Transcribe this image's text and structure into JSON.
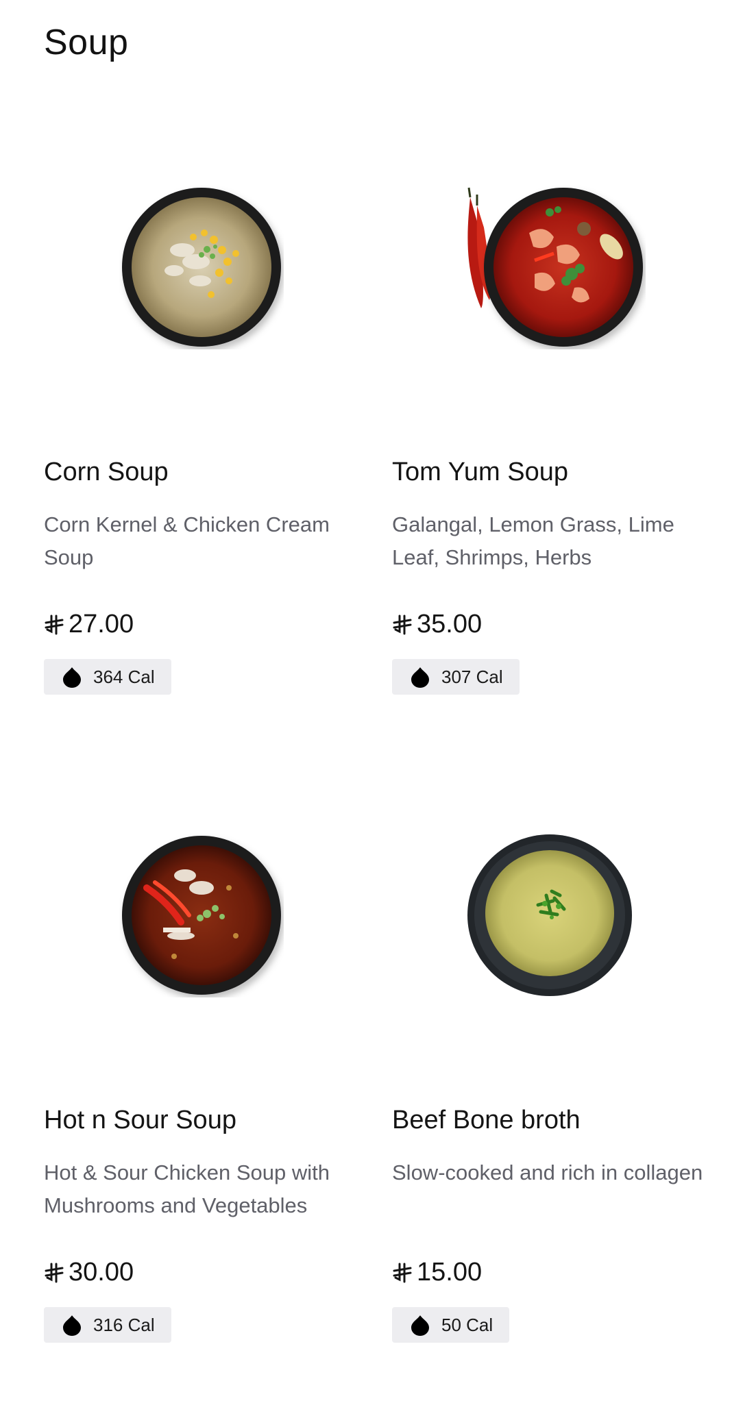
{
  "section": {
    "title": "Soup"
  },
  "currency_symbol": "⃁",
  "items": [
    {
      "name": "Corn Soup",
      "description": "Corn Kernel & Chicken Cream Soup",
      "price": "27.00",
      "calories": "364 Cal",
      "image_icon": "corn-soup-bowl"
    },
    {
      "name": "Tom Yum Soup",
      "description": "Galangal, Lemon Grass, Lime Leaf, Shrimps, Herbs",
      "price": "35.00",
      "calories": "307 Cal",
      "image_icon": "tom-yum-bowl"
    },
    {
      "name": "Hot n Sour Soup",
      "description": "Hot & Sour Chicken Soup with Mushrooms and Vegetables",
      "price": "30.00",
      "calories": "316 Cal",
      "image_icon": "hot-sour-bowl"
    },
    {
      "name": "Beef Bone broth",
      "description": "Slow-cooked and rich in collagen",
      "price": "15.00",
      "calories": "50 Cal",
      "image_icon": "bone-broth-bowl"
    }
  ]
}
